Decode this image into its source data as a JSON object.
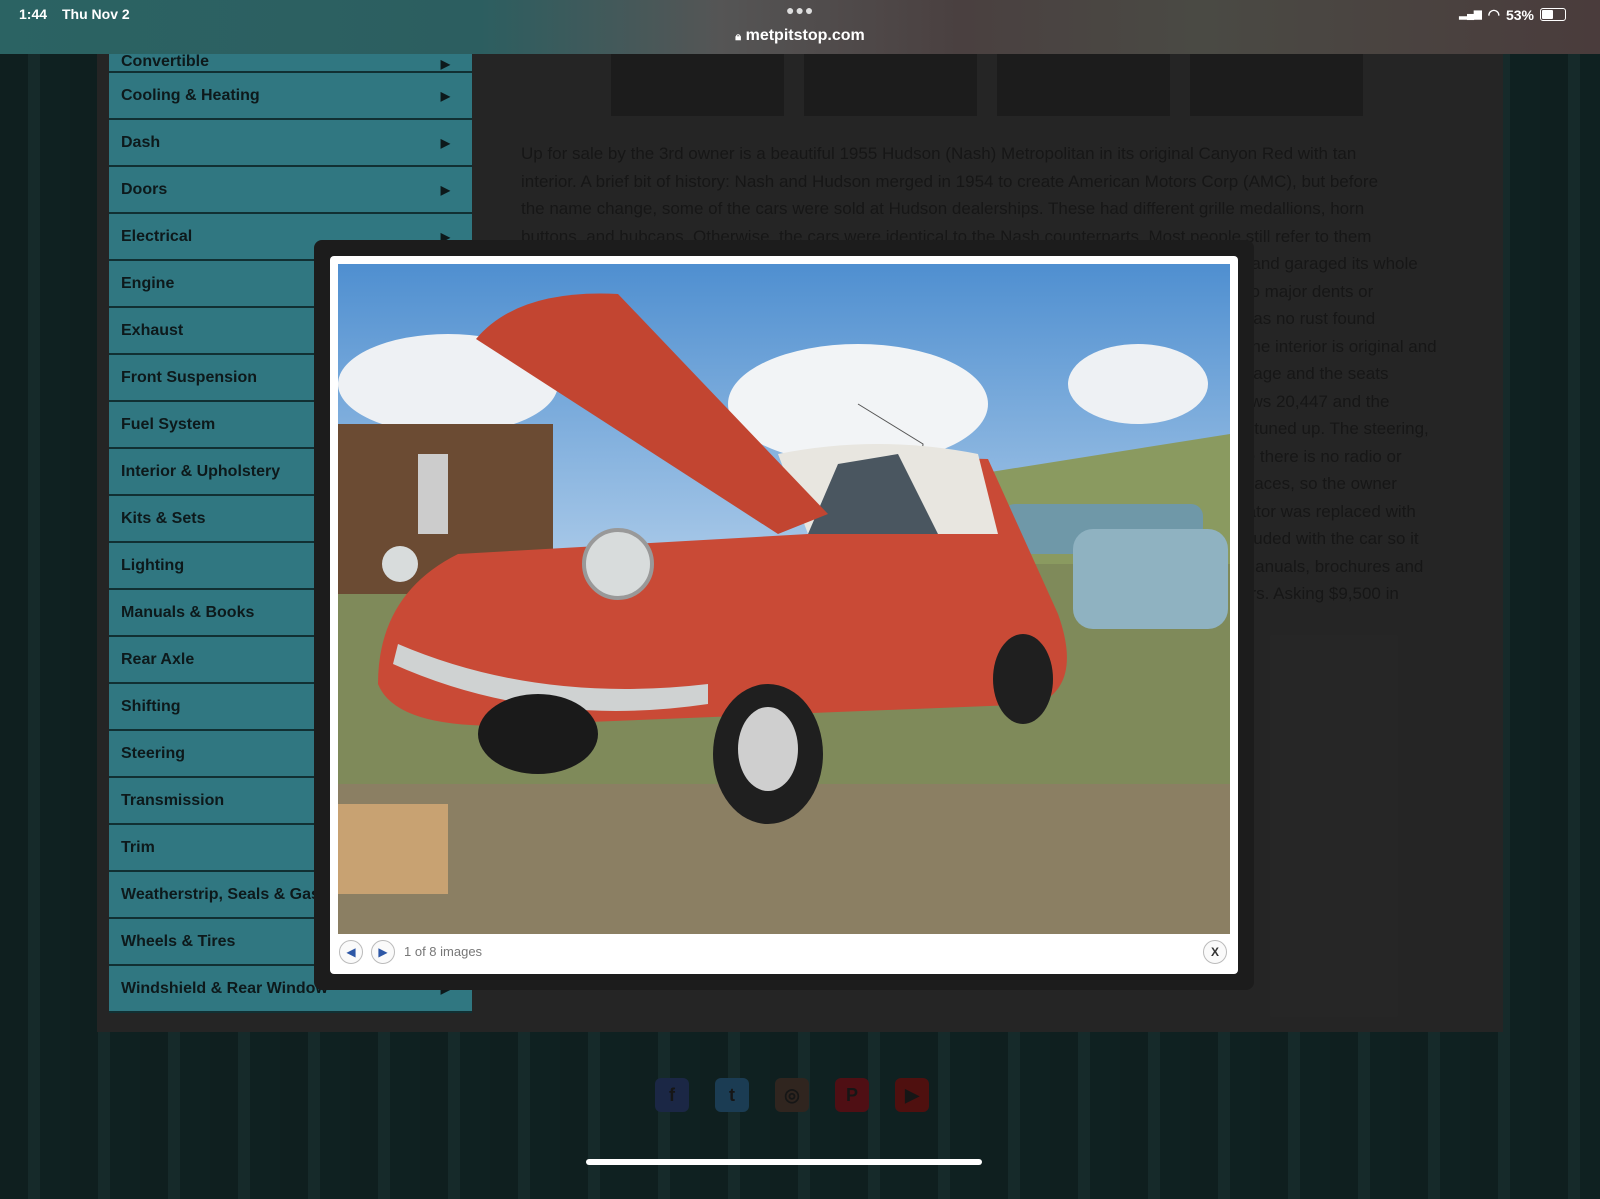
{
  "status_bar": {
    "time": "1:44",
    "date": "Thu Nov 2",
    "url": "metpitstop.com",
    "battery": "53%"
  },
  "sidebar": {
    "items": [
      {
        "label": "Convertible"
      },
      {
        "label": "Cooling & Heating"
      },
      {
        "label": "Dash"
      },
      {
        "label": "Doors"
      },
      {
        "label": "Electrical"
      },
      {
        "label": "Engine"
      },
      {
        "label": "Exhaust"
      },
      {
        "label": "Front Suspension"
      },
      {
        "label": "Fuel System"
      },
      {
        "label": "Interior & Upholstery"
      },
      {
        "label": "Kits & Sets"
      },
      {
        "label": "Lighting"
      },
      {
        "label": "Manuals & Books"
      },
      {
        "label": "Rear Axle"
      },
      {
        "label": "Shifting"
      },
      {
        "label": "Steering"
      },
      {
        "label": "Transmission"
      },
      {
        "label": "Trim"
      },
      {
        "label": "Weatherstrip, Seals & Gaskets"
      },
      {
        "label": "Wheels & Tires"
      },
      {
        "label": "Windshield & Rear Window"
      }
    ]
  },
  "article": {
    "lines": [
      "Up for sale by the 3rd owner is a beautiful 1955 Hudson (Nash) Metropolitan in its original Canyon Red with tan",
      "interior. A brief bit of history: Nash and Hudson merged in 1954 to create American Motors Corp (AMC), but before",
      "the name change, some of the cars were sold at Hudson dealerships. These had different grille medallions, horn",
      "buttons, and hubcaps. Otherwise, the cars were identical to the Nash counterparts. Most people still refer to them",
      "r and garaged its whole",
      "no major dents or",
      "was no rust found",
      "The interior is original and",
      "il age and the seats",
      "ows 20,447 and the",
      "y tuned up. The steering,",
      "te there is no radio or",
      "places, so the owner",
      "rator was replaced with",
      "cluded with the car so it",
      "manuals, brochures and",
      "ers. Asking $9,500 in"
    ]
  },
  "lightbox": {
    "counter": "1 of 8 images",
    "close_label": "X"
  },
  "footer": {
    "social": [
      "facebook",
      "twitter",
      "instagram",
      "pinterest",
      "youtube"
    ]
  }
}
